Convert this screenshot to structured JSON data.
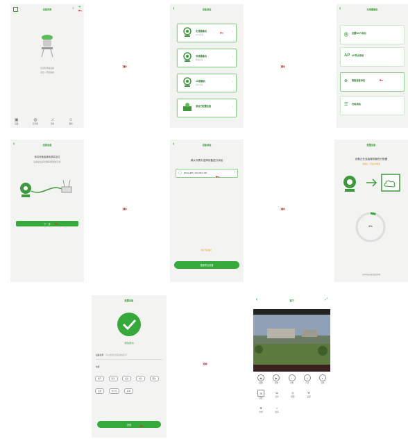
{
  "flow_arrows": [
    "»»",
    "»»",
    "»»",
    "»»",
    "»»"
  ],
  "screen1": {
    "title": "设备列表",
    "hint": "还没有添加设备",
    "hint2": "点击 + 添加设备",
    "tabs": [
      {
        "icon": "device-icon",
        "label": "设备"
      },
      {
        "icon": "cloud-icon",
        "label": "云存储"
      },
      {
        "icon": "bell-icon",
        "label": "消息"
      },
      {
        "icon": "user-icon",
        "label": "我的"
      }
    ]
  },
  "screen2": {
    "title": "设备添加",
    "items": [
      {
        "label": "无线摄像机",
        "sub": "Wi-Fi连接"
      },
      {
        "label": "有线摄像机",
        "sub": "网线连接"
      },
      {
        "label": "4G摄像机",
        "sub": "插卡连接"
      },
      {
        "label": "添加已配置设备",
        "sub": ""
      }
    ]
  },
  "screen3": {
    "title": "无线摄像机",
    "items": [
      {
        "icon": "Ⓡ",
        "label": "设置Wi-Fi添加"
      },
      {
        "icon": "AP",
        "label": "AP热点添加"
      },
      {
        "icon": "⊜",
        "label": "智能语音添加"
      },
      {
        "icon": "☰",
        "label": "扫码添加"
      }
    ]
  },
  "screen4": {
    "title": "连接设备",
    "heading": "请将设备接通电源并复位",
    "desc": "设备复位后听到等待配置提示音",
    "button": "下一步"
  },
  "screen5": {
    "title": "设备添加",
    "heading": "请从列表中选择设备进行添加",
    "device": "RKKH-IMX_192.168.0.100",
    "warning": "找不到设备？",
    "button": "搜索附近设备"
  },
  "screen6": {
    "title": "配置设备",
    "heading": "设备正在连接服务器进行配置",
    "sub": "请稍候，不要关闭电源",
    "progress": "3%",
    "progress_value": 0.03,
    "footer": "长时间未连接请检查网络"
  },
  "screen7": {
    "title": "配置设备",
    "status": "添加成功",
    "name_label": "设备名称",
    "name_hint": "可以修改为您喜欢的名字",
    "loc_label": "位置",
    "chips": [
      "客厅",
      "卧室",
      "厨房",
      "书房",
      "阳台",
      "走廊",
      "办公室",
      "其他"
    ],
    "button": "完成"
  },
  "screen8": {
    "title": "客厅",
    "controls_row1": [
      "截图",
      "录像",
      "对讲",
      "声音",
      "清晰"
    ],
    "controls_row2": [
      "回放",
      "云台",
      "报警",
      "设置"
    ],
    "controls_row3": [
      "方向",
      "更多"
    ]
  }
}
